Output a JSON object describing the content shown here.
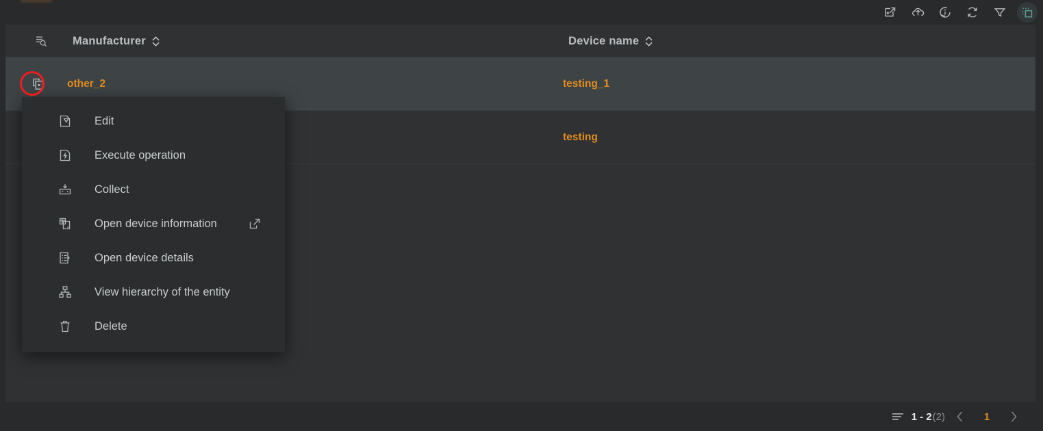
{
  "toolbar": {
    "icons": [
      {
        "name": "export-new-window-icon",
        "label": "Export"
      },
      {
        "name": "cloud-upload-icon",
        "label": "Upload"
      },
      {
        "name": "info-circle-icon",
        "label": "Information"
      },
      {
        "name": "refresh-icon",
        "label": "Refresh"
      },
      {
        "name": "filter-icon",
        "label": "Filter"
      },
      {
        "name": "multi-select-icon",
        "label": "Multi select"
      }
    ],
    "active_color": "#5f9e9b"
  },
  "table": {
    "tools_icon": "list-search-icon",
    "columns": [
      {
        "label": "Manufacturer",
        "sortable": true
      },
      {
        "label": "Device name",
        "sortable": true
      }
    ],
    "rows": [
      {
        "action_icon": "copy-layers-icon",
        "manufacturer": "other_2",
        "device_name": "testing_1",
        "selected": true
      },
      {
        "action_icon": "copy-layers-icon",
        "manufacturer": "",
        "device_name": "testing",
        "selected": false
      }
    ],
    "link_color": "#e38c1e",
    "selected_row_color": "#3e4346"
  },
  "context_menu": {
    "items": [
      {
        "label": "Edit",
        "icon": "document-edit-icon",
        "external": false
      },
      {
        "label": "Execute operation",
        "icon": "document-lightning-icon",
        "external": false
      },
      {
        "label": "Collect",
        "icon": "collect-box-icon",
        "external": false
      },
      {
        "label": "Open device information",
        "icon": "device-info-icon",
        "external": true
      },
      {
        "label": "Open device details",
        "icon": "document-list-icon",
        "external": false
      },
      {
        "label": "View hierarchy of the entity",
        "icon": "hierarchy-icon",
        "external": false
      },
      {
        "label": "Delete",
        "icon": "trash-icon",
        "external": false
      }
    ]
  },
  "annotation": {
    "name": "highlight-ring",
    "color": "#f01d1d"
  },
  "pagination": {
    "list_icon": "rows-per-page-icon",
    "range": "1 - 2",
    "total": "(2)",
    "prev_icon": "chevron-left-icon",
    "next_icon": "chevron-right-icon",
    "current_page": "1"
  }
}
